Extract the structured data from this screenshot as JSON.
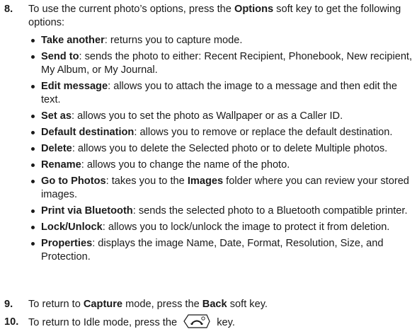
{
  "step8": {
    "number": "8.",
    "text_a": "To use the current photo’s options, press the ",
    "key": "Options",
    "text_b": " soft key to get the following options:"
  },
  "options": [
    {
      "term": "Take another",
      "desc": ": returns you to capture mode."
    },
    {
      "term": "Send to",
      "desc": ": sends the photo to either: Recent Recipient, Phonebook, New recipient, My Album, or My Journal."
    },
    {
      "term": "Edit message",
      "desc": ": allows you to attach the image to a message and then edit the text."
    },
    {
      "term": "Set as",
      "desc": ": allows you to set the photo as Wallpaper or as a Caller ID."
    },
    {
      "term": "Default destination",
      "desc": ": allows you to remove or replace the default destination."
    },
    {
      "term": "Delete",
      "desc": ": allows you to delete the Selected photo or to delete Multiple photos."
    },
    {
      "term": "Rename",
      "desc": ": allows you to change the name of the photo."
    },
    {
      "term": "Go to Photos",
      "desc_a": ": takes you to the ",
      "bold_mid": "Images",
      "desc_b": " folder where you can review your stored images."
    },
    {
      "term": "Print via Bluetooth",
      "desc": ": sends the selected photo to a Bluetooth compatible printer."
    },
    {
      "term": "Lock/Unlock",
      "desc": ": allows you to lock/unlock the image to protect it from deletion."
    },
    {
      "term": "Properties",
      "desc": ": displays the image Name, Date, Format, Resolution, Size, and Protection."
    }
  ],
  "step9": {
    "number": "9.",
    "text_a": "To return to ",
    "bold_a": "Capture",
    "text_b": " mode, press the ",
    "bold_b": "Back",
    "text_c": " soft key."
  },
  "step10": {
    "number": "10.",
    "text_a": "To return to Idle mode, press the ",
    "icon": "end-call-key-icon",
    "text_b": " key."
  }
}
